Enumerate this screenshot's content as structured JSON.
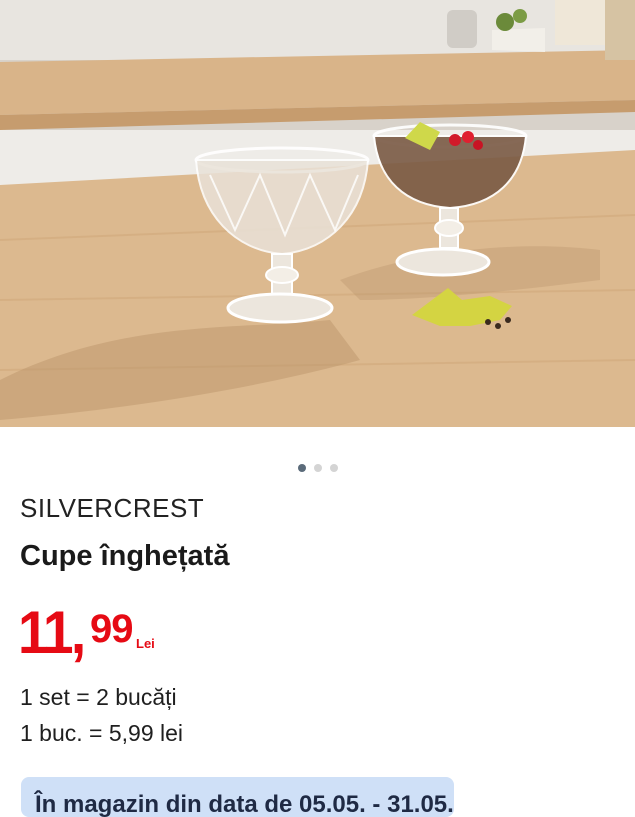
{
  "product": {
    "image_alt": "Cupe înghețată",
    "brand": "SILVERCREST",
    "title": "Cupe înghețată",
    "price_integer": "11,",
    "price_decimals": "99",
    "price_currency": "Lei",
    "pack_info": "1 set = 2 bucăți",
    "unit_price": "1 buc. = 5,99 lei",
    "availability_banner": "În magazin din data de 05.05. - 31.05."
  },
  "carousel": {
    "total": 3,
    "active_index": 0
  },
  "colors": {
    "price": "#e60a14",
    "banner_bg": "#cfe0f7",
    "dot_active": "#5b6b7a",
    "dot_inactive": "#d4d4d4"
  }
}
